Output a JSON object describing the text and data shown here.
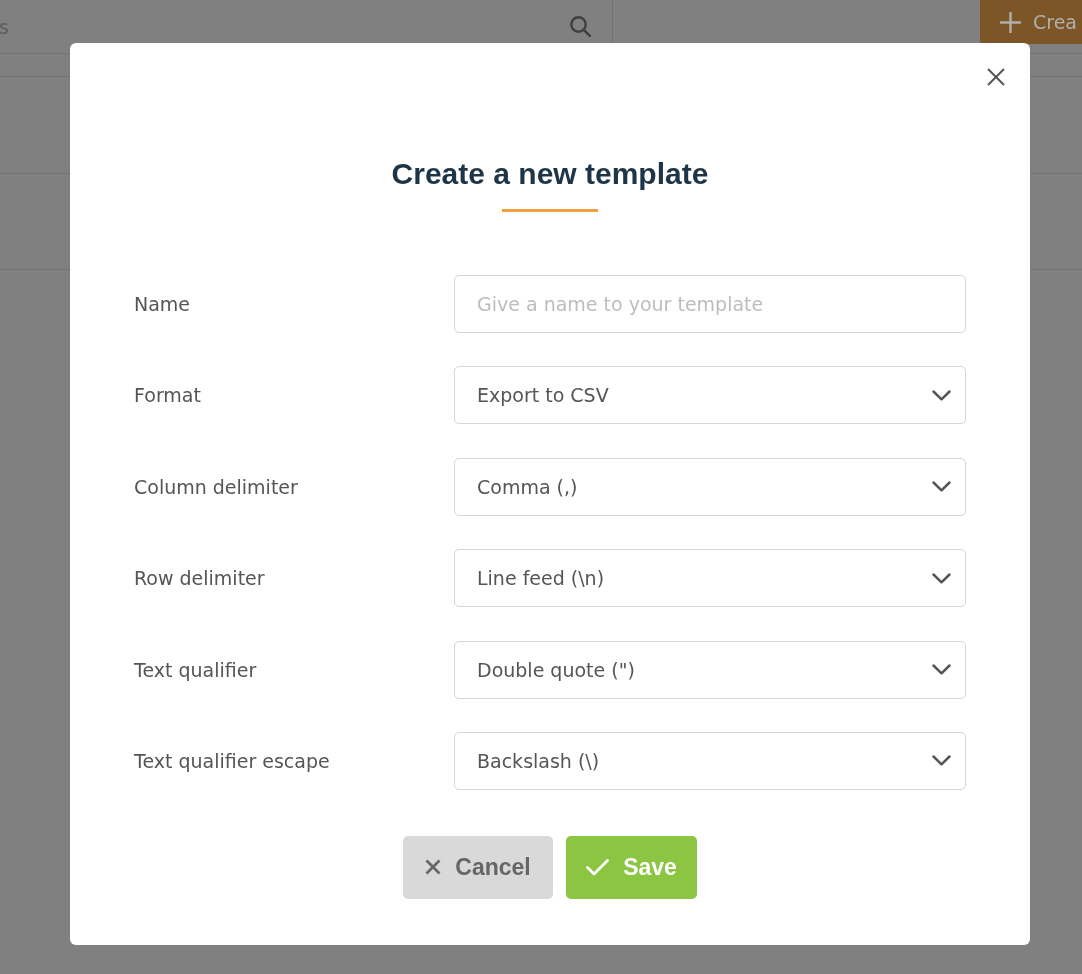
{
  "background": {
    "search": {
      "placeholder": "s"
    },
    "create_button": {
      "label": "Crea"
    }
  },
  "dialog": {
    "title": "Create a new template",
    "fields": [
      {
        "label": "Name",
        "kind": "text",
        "placeholder": "Give a name to your template"
      },
      {
        "label": "Format",
        "kind": "select",
        "value": "Export to CSV"
      },
      {
        "label": "Column delimiter",
        "kind": "select",
        "value": "Comma (,)"
      },
      {
        "label": "Row delimiter",
        "kind": "select",
        "value": "Line feed (\\n)"
      },
      {
        "label": "Text qualifier",
        "kind": "select",
        "value": "Double quote (\")"
      },
      {
        "label": "Text qualifier escape",
        "kind": "select",
        "value": "Backslash (\\)"
      }
    ],
    "buttons": [
      {
        "label": "Cancel",
        "kind": "cancel"
      },
      {
        "label": "Save",
        "kind": "save"
      }
    ]
  }
}
